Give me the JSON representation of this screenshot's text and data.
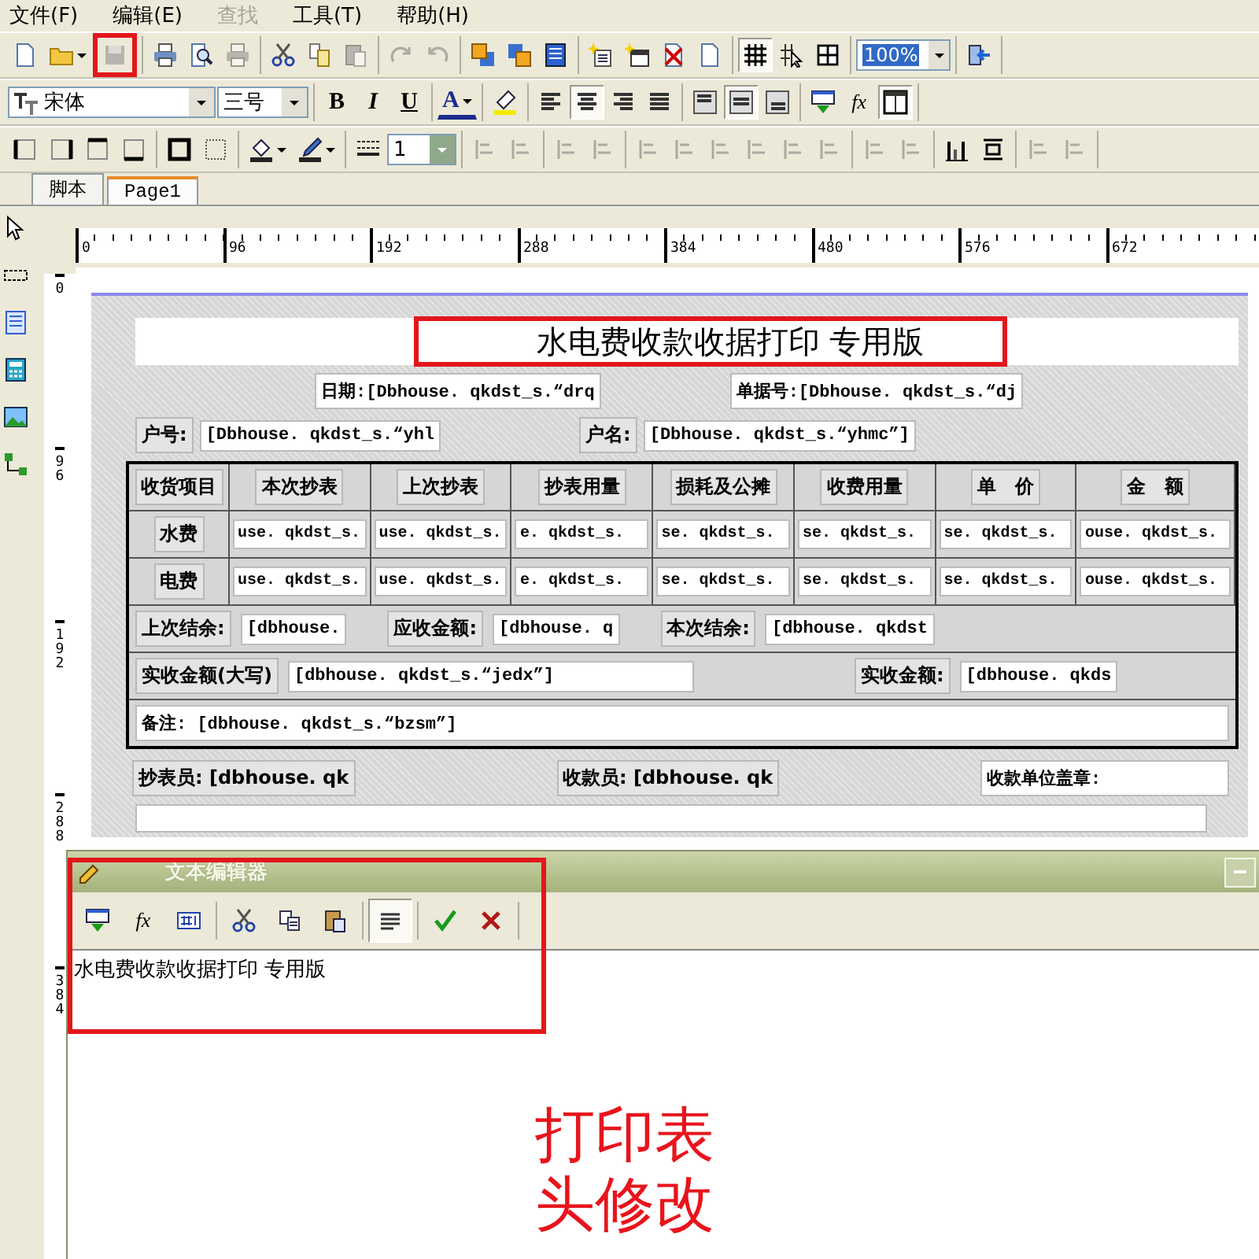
{
  "menu": [
    {
      "label": "文件(F)",
      "disabled": false
    },
    {
      "label": "编辑(E)",
      "disabled": false
    },
    {
      "label": "查找",
      "disabled": true
    },
    {
      "label": "工具(T)",
      "disabled": false
    },
    {
      "label": "帮助(H)",
      "disabled": false
    }
  ],
  "toolbars": [
    [
      [
        {
          "kind": "doc",
          "disabled": false,
          "pressed": false
        },
        {
          "kind": "folder",
          "disabled": false,
          "pressed": false
        },
        {
          "kind": "floppy",
          "disabled": true,
          "pressed": false,
          "highlighted": true
        }
      ],
      [
        {
          "kind": "printer",
          "disabled": false,
          "pressed": false
        },
        {
          "kind": "preview",
          "disabled": false,
          "pressed": false
        },
        {
          "kind": "printer",
          "disabled": true,
          "pressed": false
        }
      ],
      [
        {
          "kind": "scissors",
          "disabled": false,
          "pressed": false
        },
        {
          "kind": "copy",
          "disabled": false,
          "pressed": false
        },
        {
          "kind": "paste",
          "disabled": true,
          "pressed": false
        }
      ],
      [
        {
          "kind": "redo",
          "disabled": true,
          "pressed": false
        },
        {
          "kind": "undo",
          "disabled": true,
          "pressed": false
        }
      ],
      [
        {
          "kind": "front",
          "disabled": false,
          "pressed": false
        },
        {
          "kind": "back",
          "disabled": false,
          "pressed": false
        },
        {
          "kind": "page",
          "disabled": false,
          "pressed": false
        }
      ],
      [
        {
          "kind": "newtext",
          "disabled": false,
          "pressed": false
        },
        {
          "kind": "newwin",
          "disabled": false,
          "pressed": false
        },
        {
          "kind": "delpage",
          "disabled": false,
          "pressed": false
        },
        {
          "kind": "doc",
          "disabled": false,
          "pressed": false
        }
      ],
      [
        {
          "kind": "grid",
          "disabled": false,
          "pressed": true
        },
        {
          "kind": "gridcursor",
          "disabled": false,
          "pressed": false
        },
        {
          "kind": "panes",
          "disabled": false,
          "pressed": false
        }
      ],
      [
        {
          "kind": "zoom-combo",
          "value": "100%"
        }
      ],
      [
        {
          "kind": "exit",
          "disabled": false,
          "pressed": false
        }
      ]
    ],
    [
      [
        {
          "kind": "font-combo",
          "value": "宋体"
        },
        {
          "kind": "size-combo",
          "value": "三号"
        }
      ],
      [
        {
          "kind": "bold",
          "label": "B",
          "disabled": false,
          "pressed": false
        },
        {
          "kind": "italic",
          "label": "I",
          "disabled": false,
          "pressed": false
        },
        {
          "kind": "underline",
          "label": "U",
          "disabled": false,
          "pressed": false
        }
      ],
      [
        {
          "kind": "fontcolor",
          "label": "A",
          "disabled": false,
          "pressed": false
        }
      ],
      [
        {
          "kind": "highlighter",
          "disabled": false,
          "pressed": false
        }
      ],
      [
        {
          "kind": "align-left",
          "disabled": false,
          "pressed": false
        },
        {
          "kind": "align-center",
          "disabled": false,
          "pressed": true
        },
        {
          "kind": "align-right",
          "disabled": false,
          "pressed": false
        },
        {
          "kind": "justify",
          "disabled": false,
          "pressed": false
        }
      ],
      [
        {
          "kind": "box-top",
          "disabled": false,
          "pressed": false
        },
        {
          "kind": "box-middle",
          "disabled": false,
          "pressed": true
        },
        {
          "kind": "box-bottom",
          "disabled": false,
          "pressed": false
        }
      ],
      [
        {
          "kind": "insert-field",
          "disabled": false,
          "pressed": false
        },
        {
          "kind": "fx",
          "label": "fx",
          "disabled": false,
          "pressed": false
        },
        {
          "kind": "window",
          "disabled": false,
          "pressed": true
        }
      ]
    ],
    [
      [
        {
          "kind": "b-left",
          "disabled": false,
          "pressed": false
        },
        {
          "kind": "b-right",
          "disabled": false,
          "pressed": false
        },
        {
          "kind": "b-top",
          "disabled": false,
          "pressed": false
        },
        {
          "kind": "b-bottom",
          "disabled": false,
          "pressed": false
        }
      ],
      [
        {
          "kind": "b-all",
          "disabled": false,
          "pressed": false
        },
        {
          "kind": "b-dotted",
          "disabled": false,
          "pressed": false
        }
      ],
      [
        {
          "kind": "bucket",
          "disabled": false,
          "pressed": false
        },
        {
          "kind": "pen",
          "disabled": false,
          "pressed": false
        }
      ],
      [
        {
          "kind": "linestyle",
          "disabled": false,
          "pressed": false
        },
        {
          "kind": "spin",
          "value": "1"
        }
      ],
      [
        {
          "kind": "obj-align",
          "disabled": true,
          "pressed": false
        },
        {
          "kind": "obj-align",
          "disabled": true,
          "pressed": false
        }
      ],
      [
        {
          "kind": "obj-align",
          "disabled": true,
          "pressed": false
        },
        {
          "kind": "obj-align",
          "disabled": true,
          "pressed": false
        }
      ],
      [
        {
          "kind": "obj-align",
          "disabled": true,
          "pressed": false
        },
        {
          "kind": "obj-align",
          "disabled": true,
          "pressed": false
        },
        {
          "kind": "obj-align",
          "disabled": true,
          "pressed": false
        },
        {
          "kind": "obj-align",
          "disabled": true,
          "pressed": false
        },
        {
          "kind": "obj-align",
          "disabled": true,
          "pressed": false
        },
        {
          "kind": "obj-align",
          "disabled": true,
          "pressed": false
        }
      ],
      [
        {
          "kind": "obj-align",
          "disabled": true,
          "pressed": false
        },
        {
          "kind": "obj-align",
          "disabled": true,
          "pressed": false
        }
      ],
      [
        {
          "kind": "bars",
          "disabled": false,
          "pressed": false
        },
        {
          "kind": "center-lines",
          "disabled": false,
          "pressed": false
        }
      ],
      [
        {
          "kind": "obj-align",
          "disabled": true,
          "pressed": false
        },
        {
          "kind": "obj-align",
          "disabled": true,
          "pressed": false
        }
      ]
    ]
  ],
  "tabs": [
    {
      "label": "脚本",
      "selected": false
    },
    {
      "label": "Page1",
      "selected": true
    }
  ],
  "left_tools": [
    {
      "kind": "cursor"
    },
    {
      "kind": "dotted"
    },
    {
      "kind": "page"
    },
    {
      "kind": "calc"
    },
    {
      "kind": "image"
    },
    {
      "kind": "tree"
    }
  ],
  "ruler": [
    "0",
    "96",
    "192",
    "288",
    "384",
    "480",
    "576",
    "672"
  ],
  "vertical_ruler": [
    "0",
    "96",
    "192",
    "288",
    "384"
  ],
  "report": {
    "title": "水电费收款收据打印 专用版",
    "title_highlighted": true,
    "header_fields": [
      "日期:[Dbhouse. qkdst_s.“drq",
      "单据号:[Dbhouse. qkdst_s.“dj"
    ],
    "customer": [
      {
        "kind": "label",
        "text": "户号:"
      },
      {
        "kind": "field",
        "text": "[Dbhouse. qkdst_s.“yhl"
      },
      {
        "kind": "label",
        "text": "户名:"
      },
      {
        "kind": "field",
        "text": "[Dbhouse. qkdst_s.“yhmc”]"
      }
    ],
    "table": {
      "columns": [
        "收货项目",
        "本次抄表",
        "上次抄表",
        "抄表用量",
        "损耗及公摊",
        "收费用量",
        "单　价",
        "金　额"
      ],
      "rows": [
        {
          "cells": [
            "水费",
            "use. qkdst_s.",
            "use. qkdst_s.",
            "e. qkdst_s.",
            "se. qkdst_s.",
            "se. qkdst_s.",
            "se. qkdst_s.",
            "ouse. qkdst_s."
          ]
        },
        {
          "cells": [
            "电费",
            "use. qkdst_s.",
            "use. qkdst_s.",
            "e. qkdst_s.",
            "se. qkdst_s.",
            "se. qkdst_s.",
            "se. qkdst_s.",
            "ouse. qkdst_s."
          ]
        }
      ]
    },
    "summary_rows": [
      [
        {
          "kind": "label",
          "text": "上次结余:"
        },
        {
          "kind": "field",
          "text": "[dbhouse."
        },
        {
          "kind": "label",
          "text": "应收金额:"
        },
        {
          "kind": "field",
          "text": "[dbhouse. q"
        },
        {
          "kind": "label",
          "text": "本次结余:"
        },
        {
          "kind": "field",
          "text": "[dbhouse. qkdst"
        }
      ],
      [
        {
          "kind": "label",
          "text": "实收金额(大写)"
        },
        {
          "kind": "wide-field",
          "text": "[dbhouse. qkdst_s.“jedx”]"
        },
        {
          "kind": "label",
          "text": "实收金额:"
        },
        {
          "kind": "field",
          "text": "[dbhouse. qkds"
        }
      ],
      [
        {
          "kind": "full-field",
          "text": "备注: [dbhouse. qkdst_s.“bzsm”]"
        }
      ]
    ],
    "footer": [
      {
        "kind": "label",
        "text": "抄表员: [dbhouse. qk"
      },
      {
        "kind": "label",
        "text": "收款员: [dbhouse. qk"
      },
      {
        "kind": "field",
        "text": "收款单位盖章:"
      }
    ]
  },
  "editor": {
    "title": "文本编辑器",
    "highlighted": true,
    "tools": [
      [
        {
          "kind": "insert-field",
          "disabled": false,
          "pressed": false
        },
        {
          "kind": "fx",
          "label": "fx",
          "disabled": false,
          "pressed": false
        },
        {
          "kind": "format",
          "disabled": false,
          "pressed": false
        }
      ],
      [
        {
          "kind": "scissors",
          "disabled": false,
          "pressed": false
        },
        {
          "kind": "copy2",
          "disabled": false,
          "pressed": false
        },
        {
          "kind": "paste2",
          "disabled": false,
          "pressed": false
        }
      ],
      [
        {
          "kind": "lines",
          "disabled": false,
          "pressed": true
        }
      ],
      [
        {
          "kind": "check",
          "disabled": false,
          "pressed": false
        },
        {
          "kind": "cross",
          "disabled": false,
          "pressed": false
        }
      ]
    ],
    "text": "水电费收款收据打印 专用版"
  },
  "annotation": "打印表头修改"
}
